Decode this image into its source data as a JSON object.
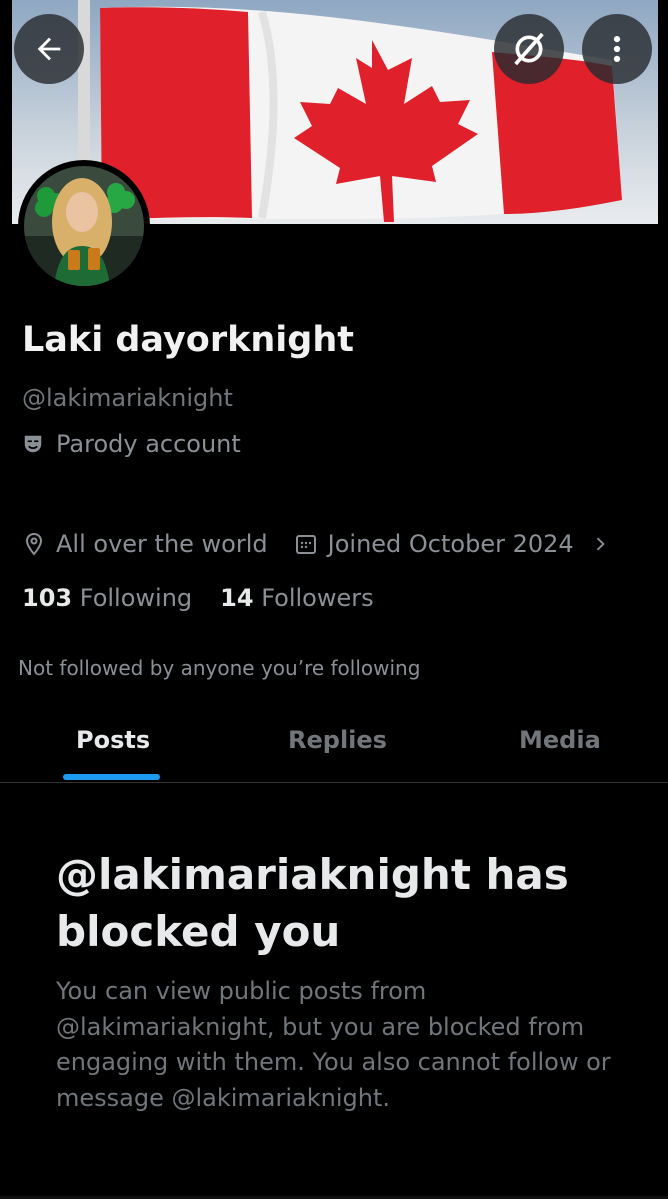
{
  "profile": {
    "name": "Laki dayorknight",
    "handle": "@lakimariaknight",
    "parody_label": "Parody account",
    "location": "All over the world",
    "joined": "Joined October 2024",
    "following_count": "103",
    "following_label": "Following",
    "followers_count": "14",
    "followers_label": "Followers",
    "not_followed_text": "Not followed by anyone you’re following"
  },
  "header": {
    "back_icon": "arrow-left-icon",
    "grok_icon": "grok-icon",
    "more_icon": "more-vertical-icon"
  },
  "tabs": [
    {
      "label": "Posts",
      "active": true
    },
    {
      "label": "Replies",
      "active": false
    },
    {
      "label": "Media",
      "active": false
    }
  ],
  "blocked": {
    "title": "@lakimariaknight has blocked you",
    "body": "You can view public posts from @lakimariaknight, but you are blocked from engaging with them. You also cannot follow or message @lakimariaknight."
  },
  "colors": {
    "background": "#000000",
    "primary_text": "#e7e9ea",
    "secondary_text": "#71767b",
    "accent": "#1d9bf0",
    "flag_red": "#e0202a"
  }
}
